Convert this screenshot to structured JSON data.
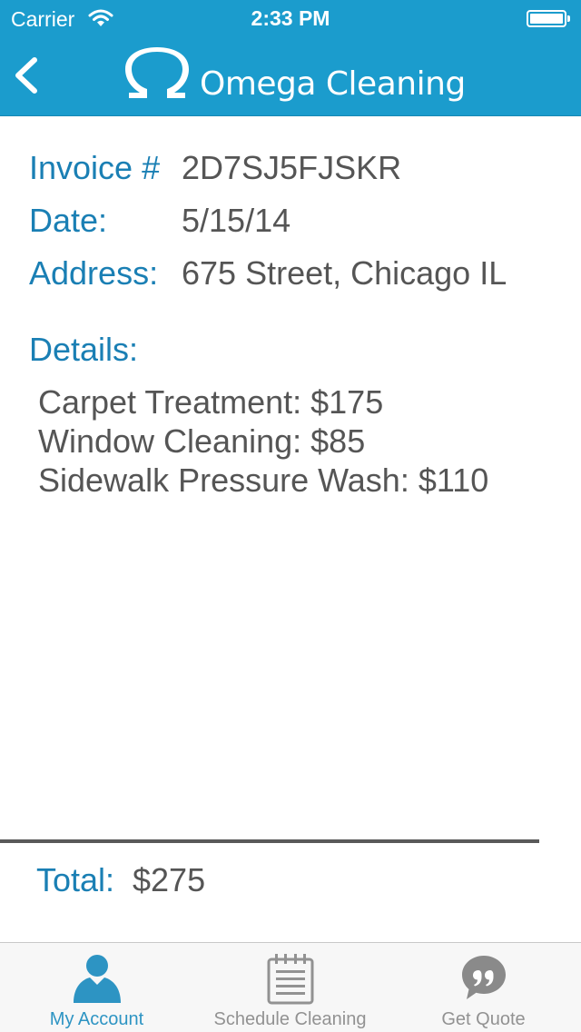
{
  "status_bar": {
    "carrier": "Carrier",
    "time": "2:33 PM"
  },
  "nav": {
    "brand": "Omega Cleaning",
    "color": "#1b9ccd"
  },
  "invoice": {
    "invoice_label": "Invoice #",
    "invoice_value": "2D7SJ5FJSKR",
    "date_label": "Date:",
    "date_value": "5/15/14",
    "address_label": "Address:",
    "address_value": "675 Street, Chicago IL",
    "details_label": "Details:",
    "items": [
      "Carpet Treatment: $175",
      "Window Cleaning: $85",
      "Sidewalk Pressure Wash: $110"
    ],
    "total_label": "Total:",
    "total_value": "$275"
  },
  "tabs": [
    {
      "label": "My Account",
      "icon": "person-icon",
      "active": true
    },
    {
      "label": "Schedule Cleaning",
      "icon": "clipboard-icon",
      "active": false
    },
    {
      "label": "Get Quote",
      "icon": "speech-bubble-icon",
      "active": false
    }
  ]
}
